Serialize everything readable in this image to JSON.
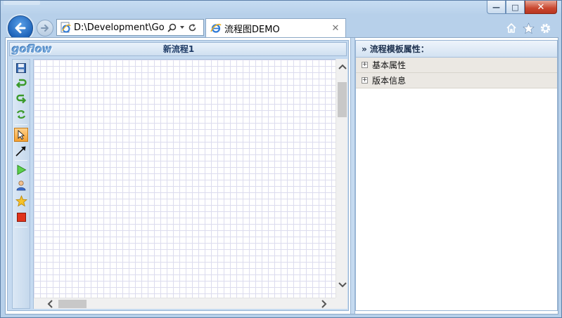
{
  "browser": {
    "address_url": "D:\\Development\\GoFlow\\",
    "tab_title": "流程图DEMO",
    "tab_close": "✕",
    "window_buttons": {
      "minimize": "—",
      "maximize": "□",
      "close": "✕"
    }
  },
  "designer": {
    "logo_text": "goflow",
    "flow_name": "新流程1",
    "toolbar": [
      "save-icon",
      "undo-icon",
      "redo-icon",
      "refresh-icon",
      "select-pointer-icon",
      "connector-arrow-icon",
      "start-node-icon",
      "user-task-icon",
      "star-node-icon",
      "end-node-icon"
    ]
  },
  "properties": {
    "header_arrow": "»",
    "header": "流程模板属性：",
    "groups": [
      {
        "expander": "+",
        "label": "基本属性"
      },
      {
        "expander": "+",
        "label": "版本信息"
      }
    ]
  },
  "colors": {
    "frame": "#b7d0ea",
    "accent_blue": "#1d62b8",
    "active_tool": "#f5a030",
    "grid_line": "#dcdcee",
    "property_group_bg": "#ebe8e3"
  }
}
